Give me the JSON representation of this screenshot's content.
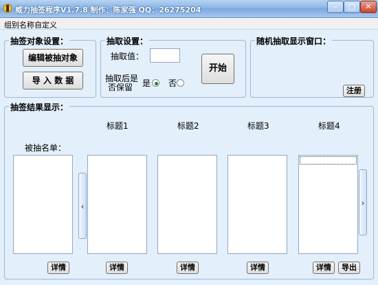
{
  "window": {
    "title": "威力抽签程序V1.7.8  制作：陈家强  QQ：26275204",
    "minimize": "–",
    "maximize": "□",
    "close": "✕"
  },
  "menu": {
    "item": "组别名称自定义"
  },
  "group_target": {
    "label": "抽签对象设置：",
    "edit_button": "编辑被抽对象",
    "import_button": "导 入 数 据"
  },
  "group_draw": {
    "label": "抽取设置：",
    "count_label": "抽取值：",
    "count_value": "",
    "keep_label_line1": "抽取后是",
    "keep_label_line2": "否保留",
    "yes_label": "是",
    "no_label": "否",
    "start_button": "开始"
  },
  "group_display": {
    "label": "随机抽取显示窗口：",
    "register_button": "注册"
  },
  "group_results": {
    "label": "抽签结果显示：",
    "list_label": "被抽名单：",
    "headers": [
      "标题1",
      "标题2",
      "标题3",
      "标题4"
    ],
    "left_arrow": "‹",
    "right_arrow": "›",
    "detail_buttons": [
      "详情",
      "详情",
      "详情",
      "详情",
      "详情"
    ],
    "export_button": "导出"
  }
}
